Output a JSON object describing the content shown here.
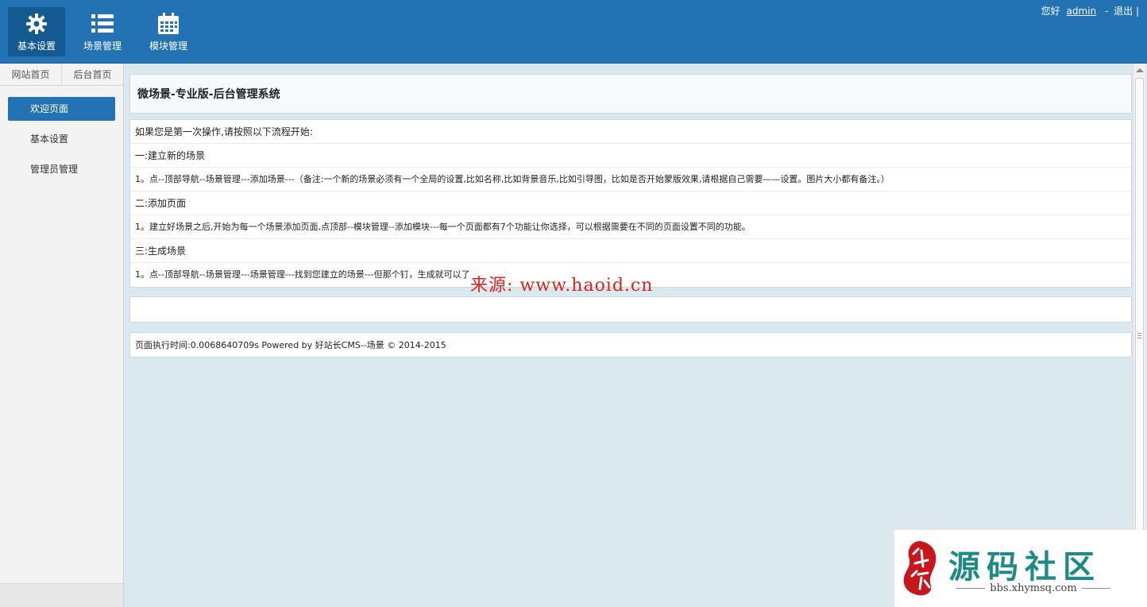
{
  "header": {
    "nav": [
      {
        "label": "基本设置",
        "icon": "gear-icon",
        "active": true
      },
      {
        "label": "场景管理",
        "icon": "list-icon",
        "active": false
      },
      {
        "label": "模块管理",
        "icon": "calendar-icon",
        "active": false
      }
    ],
    "user": {
      "greeting": "您好",
      "username": "admin",
      "separator": "-",
      "logout": "退出",
      "trailing": "|"
    },
    "color": "#2272b4"
  },
  "sidebar": {
    "tabs": [
      "网站首页",
      "后台首页"
    ],
    "items": [
      {
        "label": "欢迎页面",
        "active": true
      },
      {
        "label": "基本设置",
        "active": false
      },
      {
        "label": "管理员管理",
        "active": false
      }
    ]
  },
  "main": {
    "title": "微场景-专业版-后台管理系统",
    "rows": [
      "如果您是第一次操作,请按照以下流程开始:",
      "一:建立新的场景",
      "1。点--顶部导航--场景管理---添加场景---（备注:一个新的场景必须有一个全局的设置,比如名称,比如背景音乐,比如引导图，比如是否开始蒙版效果,请根据自己需要——设置。图片大小都有备注。）",
      "二:添加页面",
      "1。建立好场景之后,开始为每一个场景添加页面,点顶部--模块管理--添加模块---每一个页面都有7个功能让你选择，可以根据需要在不同的页面设置不同的功能。",
      "三:生成场景",
      "1。点--顶部导航--场景管理---场景管理---找到您建立的场景---但那个钉，生成就可以了"
    ],
    "footer": "页面执行时间:0.0068640709s Powered by 好站长CMS--场景 © 2014-2015"
  },
  "watermark": "来源: www.haoid.cn",
  "logo": {
    "title": "源码社区",
    "subtitle": "bbs.xhymsq.com"
  }
}
